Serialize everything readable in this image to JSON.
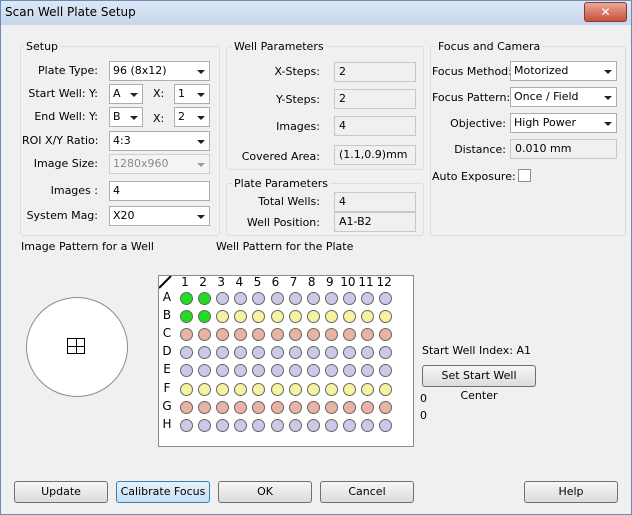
{
  "title": "Scan Well Plate Setup",
  "close_glyph": "✕",
  "setup": {
    "heading": "Setup",
    "plate_type_label": "Plate Type:",
    "plate_type": "96 (8x12)",
    "start_well_label": "Start Well: Y:",
    "start_y": "A",
    "start_x_label": "X:",
    "start_x": "1",
    "end_well_label": "End Well: Y:",
    "end_y": "B",
    "end_x_label": "X:",
    "end_x": "2",
    "roi_label": "ROI X/Y Ratio:",
    "roi": "4:3",
    "image_size_label": "Image Size:",
    "image_size": "1280x960",
    "images_label": "Images :",
    "images": "4",
    "system_mag_label": "System Mag:",
    "system_mag": "X20"
  },
  "well_params": {
    "heading": "Well Parameters",
    "x_steps_label": "X-Steps:",
    "x_steps": "2",
    "y_steps_label": "Y-Steps:",
    "y_steps": "2",
    "images_label": "Images:",
    "images": "4",
    "covered_label": "Covered Area:",
    "covered": "(1.1,0.9)mm"
  },
  "plate_params": {
    "heading": "Plate Parameters",
    "total_wells_label": "Total Wells:",
    "total_wells": "4",
    "well_position_label": "Well Position:",
    "well_position": "A1-B2"
  },
  "focus": {
    "heading": "Focus and Camera",
    "method_label": "Focus Method:",
    "method": "Motorized",
    "pattern_label": "Focus Pattern:",
    "pattern": "Once / Field",
    "objective_label": "Objective:",
    "objective": "High Power",
    "distance_label": "Distance:",
    "distance": "0.010 mm",
    "auto_exposure_label": "Auto Exposure:"
  },
  "image_pattern_label": "Image Pattern for a Well",
  "well_pattern_label": "Well Pattern for the Plate",
  "plate": {
    "columns": [
      "1",
      "2",
      "3",
      "4",
      "5",
      "6",
      "7",
      "8",
      "9",
      "10",
      "11",
      "12"
    ],
    "rows": [
      "A",
      "B",
      "C",
      "D",
      "E",
      "F",
      "G",
      "H"
    ],
    "row_colors": [
      "#c9c9e8",
      "#f5f2a2",
      "#e8b3a3",
      "#c9c9e8",
      "#c9c9e8",
      "#f5f2a2",
      "#e8b3a3",
      "#c9c9e8"
    ],
    "selected_color": "#22dd22",
    "selected_wells": [
      "A1",
      "A2",
      "B1",
      "B2"
    ]
  },
  "start_well_index": "Start Well Index: A1",
  "set_center_label": "Set Start Well Center",
  "coord_1": "0",
  "coord_2": "0",
  "buttons": {
    "update": "Update",
    "calibrate": "Calibrate Focus",
    "ok": "OK",
    "cancel": "Cancel",
    "help": "Help"
  }
}
